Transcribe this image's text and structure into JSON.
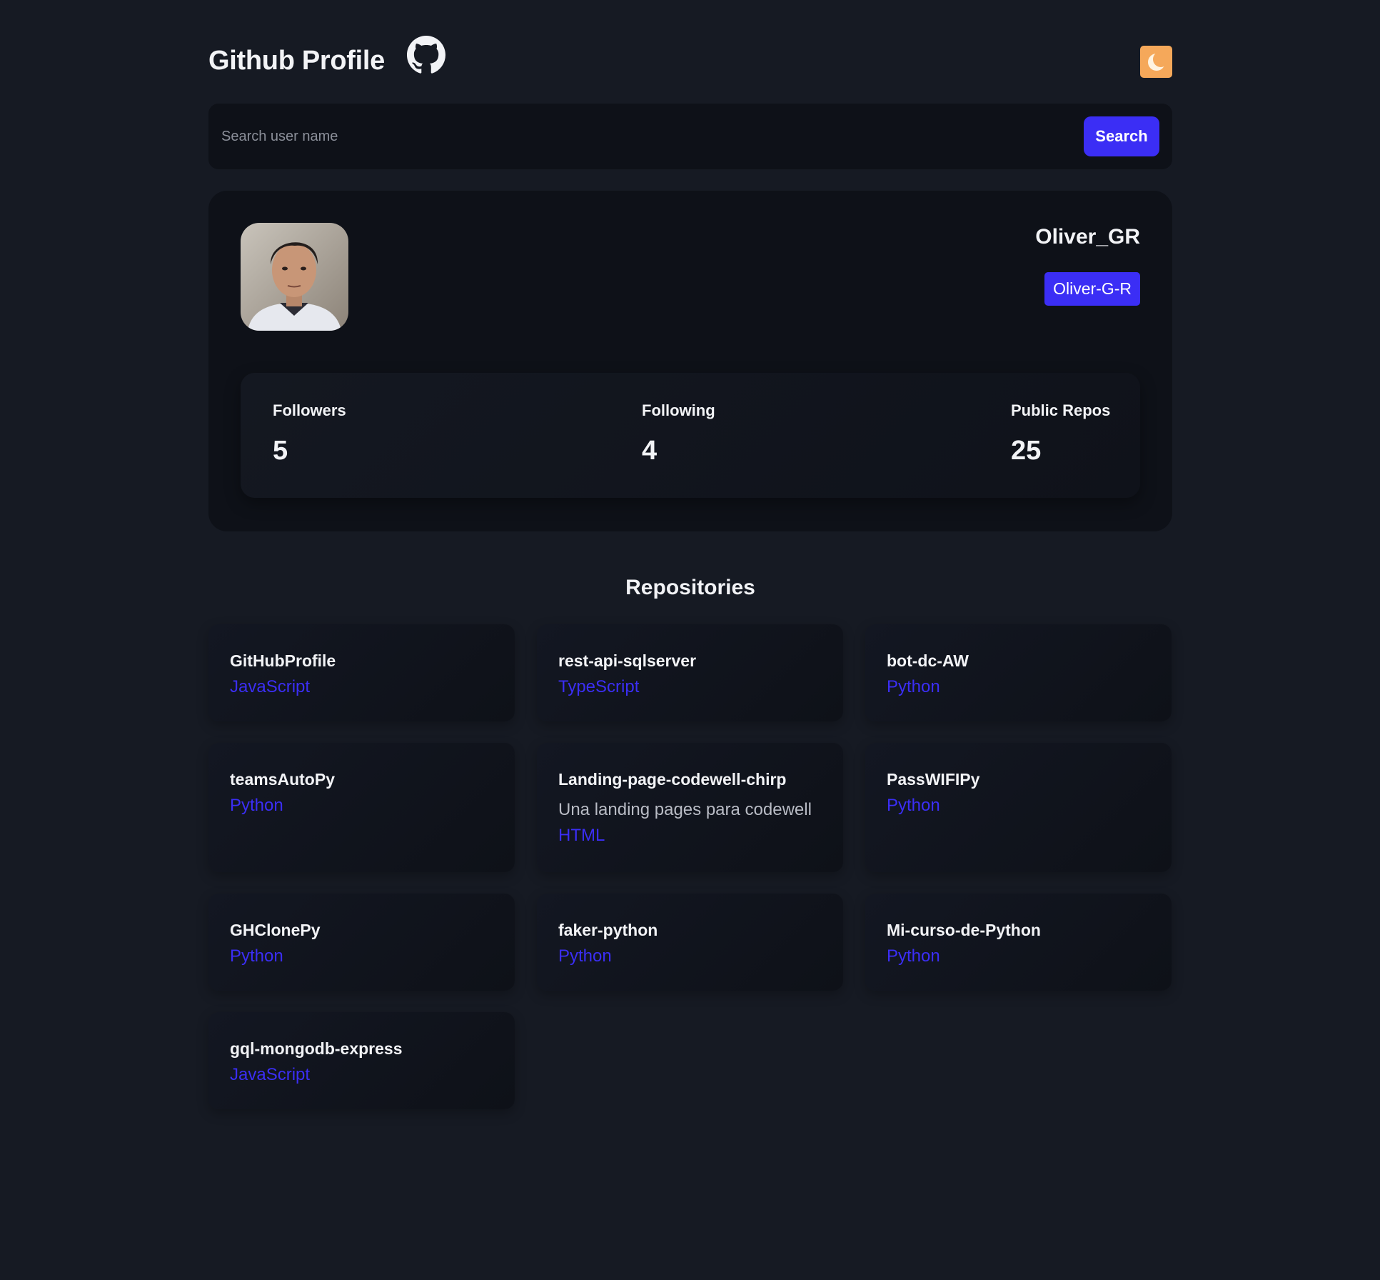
{
  "header": {
    "title": "Github Profile",
    "logo_icon": "github-icon",
    "theme_toggle_icon": "moon-icon",
    "accent_color": "#3b2ef5",
    "toggle_color": "#f5a85a"
  },
  "search": {
    "placeholder": "Search user name",
    "value": "",
    "button_label": "Search"
  },
  "profile": {
    "name": "Oliver_GR",
    "login": "Oliver-G-R",
    "avatar_icon": "user-avatar",
    "stats": [
      {
        "label": "Followers",
        "value": "5"
      },
      {
        "label": "Following",
        "value": "4"
      },
      {
        "label": "Public Repos",
        "value": "25"
      }
    ]
  },
  "repositories": {
    "title": "Repositories",
    "items": [
      {
        "name": "GitHubProfile",
        "description": "",
        "language": "JavaScript"
      },
      {
        "name": "rest-api-sqlserver",
        "description": "",
        "language": "TypeScript"
      },
      {
        "name": "bot-dc-AW",
        "description": "",
        "language": "Python"
      },
      {
        "name": "teamsAutoPy",
        "description": "",
        "language": "Python"
      },
      {
        "name": "Landing-page-codewell-chirp",
        "description": "Una landing pages para codewell",
        "language": "HTML"
      },
      {
        "name": "PassWIFIPy",
        "description": "",
        "language": "Python"
      },
      {
        "name": "GHClonePy",
        "description": "",
        "language": "Python"
      },
      {
        "name": "faker-python",
        "description": "",
        "language": "Python"
      },
      {
        "name": "Mi-curso-de-Python",
        "description": "",
        "language": "Python"
      },
      {
        "name": "gql-mongodb-express",
        "description": "",
        "language": "JavaScript"
      }
    ]
  }
}
